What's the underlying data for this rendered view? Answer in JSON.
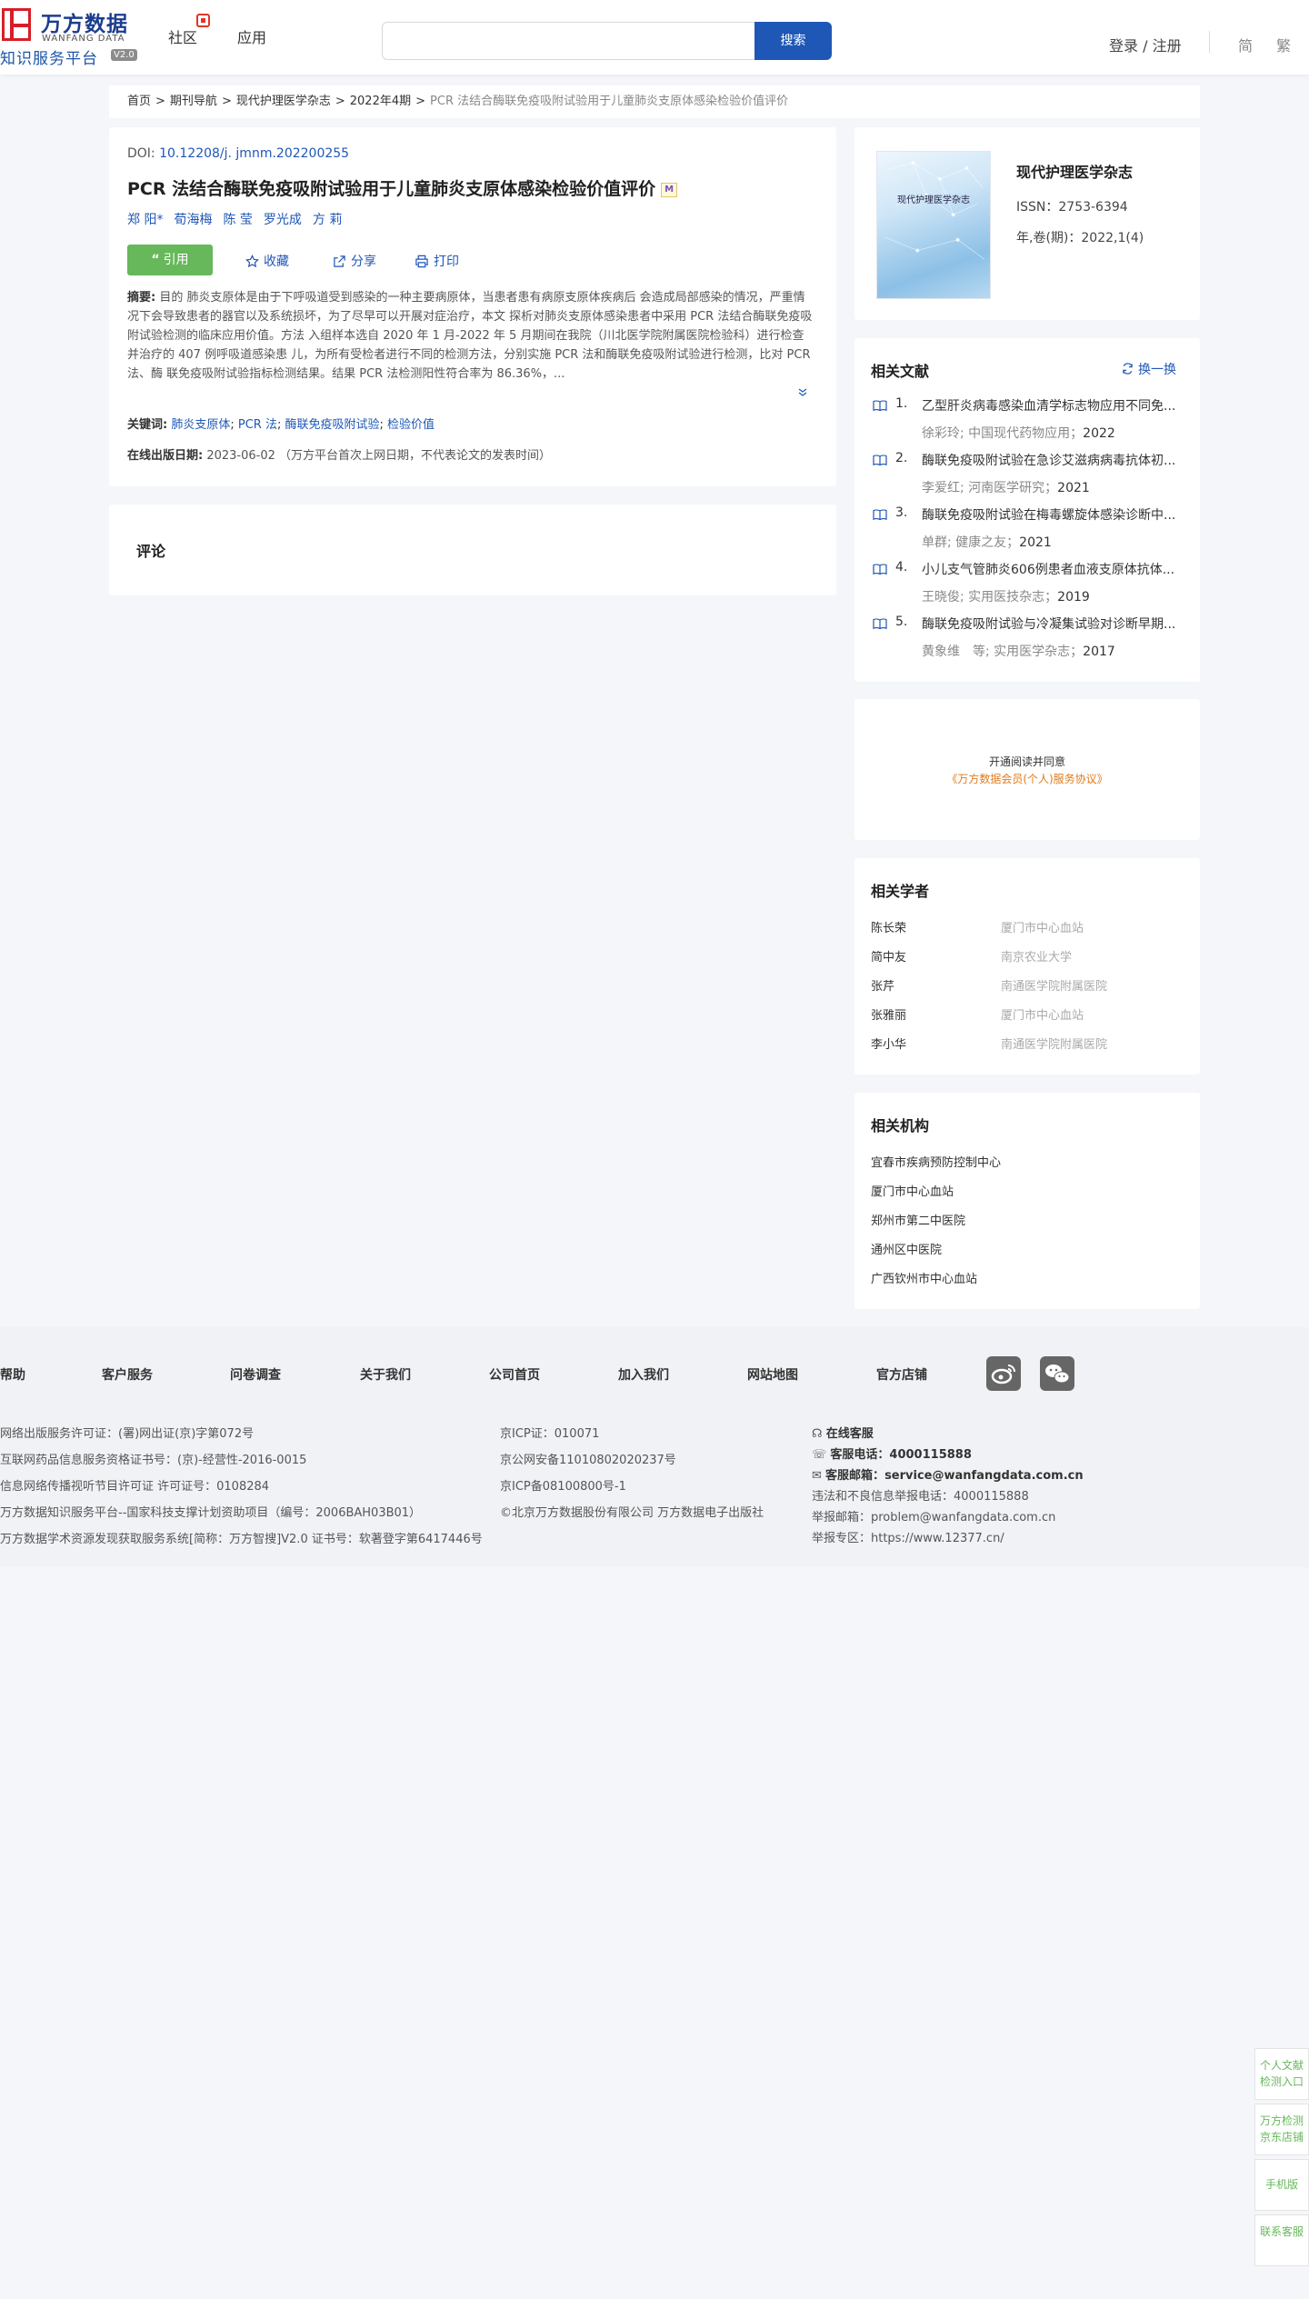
{
  "header": {
    "logo_cn": "万方数据",
    "logo_en": "WANFANG DATA",
    "platform": "知识服务平台",
    "version": "V2.0",
    "nav": [
      "社区",
      "应用"
    ],
    "search_placeholder": "",
    "search_button": "搜索",
    "login": "登录 / 注册",
    "lang_simplified": "简",
    "lang_traditional": "繁"
  },
  "breadcrumb": {
    "items": [
      "首页",
      "期刊导航",
      "现代护理医学杂志",
      "2022年4期"
    ],
    "current": "PCR 法结合酶联免疫吸附试验用于儿童肺炎支原体感染检验价值评价",
    "separator": ">"
  },
  "article": {
    "doi_label": "DOI: ",
    "doi": "10.12208/j. jmnm.202200255",
    "title": "PCR 法结合酶联免疫吸附试验用于儿童肺炎支原体感染检验价值评价",
    "title_badge": "M",
    "authors": [
      "郑 阳*",
      "荀海梅",
      "陈 莹",
      "罗光成",
      "方 莉"
    ],
    "actions": {
      "cite": "引用",
      "favorite": "收藏",
      "share": "分享",
      "print": "打印"
    },
    "abstract_label": "摘要:",
    "abstract": " 目的 肺炎支原体是由于下呼吸道受到感染的一种主要病原体，当患者患有病原支原体疾病后 会造成局部感染的情况，严重情况下会导致患者的器官以及系统损坏，为了尽早可以开展对症治疗，本文 探析对肺炎支原体感染患者中采用 PCR 法结合酶联免疫吸附试验检测的临床应用价值。方法 入组样本选自 2020 年 1 月-2022 年 5 月期间在我院（川北医学院附属医院检验科）进行检查并治疗的 407 例呼吸道感染患 儿，为所有受检者进行不同的检测方法，分别实施 PCR 法和酶联免疫吸附试验进行检测，比对 PCR 法、酶 联免疫吸附试验指标检测结果。结果 PCR 法检测阳性符合率为 86.36%，...",
    "keywords_label": "关键词:",
    "keywords": [
      "肺炎支原体",
      "PCR 法",
      "酶联免疫吸附试验",
      "检验价值"
    ],
    "pubdate_label": "在线出版日期:",
    "pubdate": "2023-06-02",
    "pubdate_note": "（万方平台首次上网日期，不代表论文的发表时间）"
  },
  "comment": {
    "title": "评论"
  },
  "journal": {
    "cover_text": "现代护理医学杂志",
    "name": "现代护理医学杂志",
    "issn": "ISSN：2753-6394",
    "volume": "年,卷(期)：2022,1(4)"
  },
  "related_docs": {
    "title": "相关文献",
    "refresh": "换一换",
    "items": [
      {
        "num": "1.",
        "title": "乙型肝炎病毒感染血清学标志物应用不同免...",
        "meta": "徐彩玲; 中国现代药物应用",
        "year": "2022"
      },
      {
        "num": "2.",
        "title": "酶联免疫吸附试验在急诊艾滋病病毒抗体初...",
        "meta": "李爱红; 河南医学研究",
        "year": "2021"
      },
      {
        "num": "3.",
        "title": "酶联免疫吸附试验在梅毒螺旋体感染诊断中...",
        "meta": "单群; 健康之友",
        "year": "2021"
      },
      {
        "num": "4.",
        "title": "小儿支气管肺炎606例患者血液支原体抗体...",
        "meta": "王晓俊; 实用医技杂志",
        "year": "2019"
      },
      {
        "num": "5.",
        "title": "酶联免疫吸附试验与冷凝集试验对诊断早期...",
        "meta": "黄象维　等; 实用医学杂志",
        "year": "2017"
      }
    ]
  },
  "open_read": {
    "line1": "开通阅读并同意",
    "line2": "《万方数据会员(个人)服务协议》"
  },
  "scholars": {
    "title": "相关学者",
    "items": [
      {
        "name": "陈长荣",
        "org": "厦门市中心血站"
      },
      {
        "name": "简中友",
        "org": "南京农业大学"
      },
      {
        "name": "张芹",
        "org": "南通医学院附属医院"
      },
      {
        "name": "张雅丽",
        "org": "厦门市中心血站"
      },
      {
        "name": "李小华",
        "org": "南通医学院附属医院"
      }
    ]
  },
  "institutions": {
    "title": "相关机构",
    "items": [
      "宜春市疾病预防控制中心",
      "厦门市中心血站",
      "郑州市第二中医院",
      "通州区中医院",
      "广西钦州市中心血站"
    ]
  },
  "footer": {
    "nav": [
      "帮助",
      "客户服务",
      "问卷调查",
      "关于我们",
      "公司首页",
      "加入我们",
      "网站地图",
      "官方店铺"
    ],
    "col1": [
      "网络出版服务许可证：(署)网出证(京)字第072号",
      "互联网药品信息服务资格证书号：(京)-经营性-2016-0015",
      "信息网络传播视听节目许可证 许可证号：0108284",
      "万方数据知识服务平台--国家科技支撑计划资助项目（编号：2006BAH03B01）",
      "万方数据学术资源发现获取服务系统[简称：万方智搜]V2.0 证书号：软著登字第6417446号"
    ],
    "col2": [
      "京ICP证：010071",
      "京公网安备11010802020237号",
      "京ICP备08100800号-1",
      "©北京万方数据股份有限公司 万方数据电子出版社"
    ],
    "online_service": "在线客服",
    "phone_label": "客服电话：",
    "phone": "4000115888",
    "email_label": "客服邮箱：",
    "email": "service@wanfangdata.com.cn",
    "report_phone": "违法和不良信息举报电话：4000115888",
    "report_email": "举报邮箱：problem@wanfangdata.com.cn",
    "report_zone": "举报专区：https://www.12377.cn/"
  },
  "side_float": [
    "个人文献检测入口",
    "万方检测京东店铺",
    "手机版",
    "联系客服"
  ]
}
